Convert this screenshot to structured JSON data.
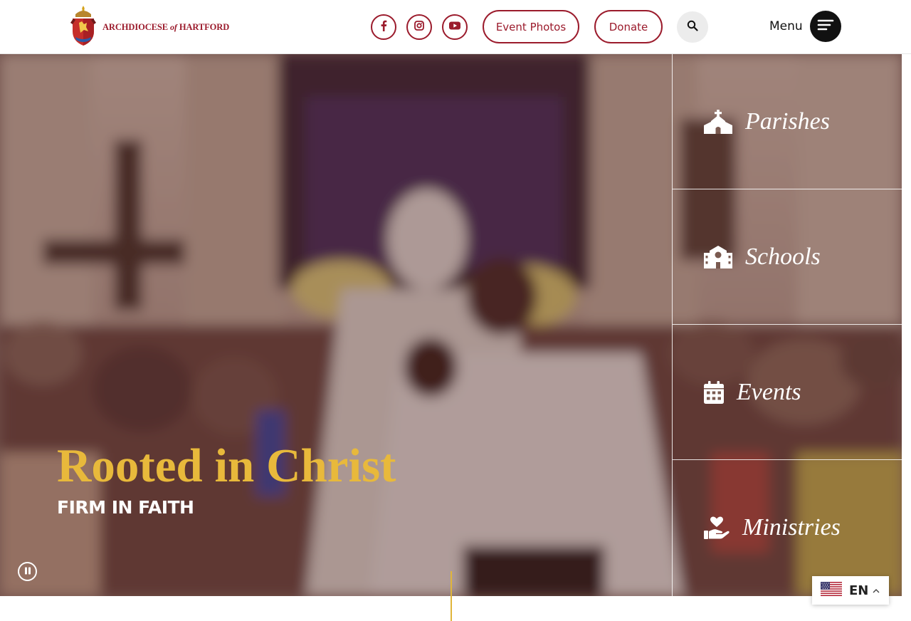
{
  "header": {
    "logo_text_main": "ARCHDIOCESE",
    "logo_text_of": "of",
    "logo_text_city": "HARTFORD",
    "social": [
      {
        "name": "facebook-icon"
      },
      {
        "name": "instagram-icon"
      },
      {
        "name": "youtube-icon"
      }
    ],
    "event_photos_label": "Event Photos",
    "donate_label": "Donate",
    "menu_label": "Menu",
    "brand_color": "#9b1b2c"
  },
  "hero": {
    "title": "Rooted in Christ",
    "subtitle": "FIRM IN FAITH",
    "title_color": "#e8b93b"
  },
  "quick_links": [
    {
      "label": "Parishes",
      "icon": "church-icon"
    },
    {
      "label": "Schools",
      "icon": "school-icon"
    },
    {
      "label": "Events",
      "icon": "calendar-icon"
    },
    {
      "label": "Ministries",
      "icon": "hand-heart-icon"
    }
  ],
  "language": {
    "code": "EN",
    "flag": "us-flag-icon"
  },
  "accent_color": "#e0b53a"
}
